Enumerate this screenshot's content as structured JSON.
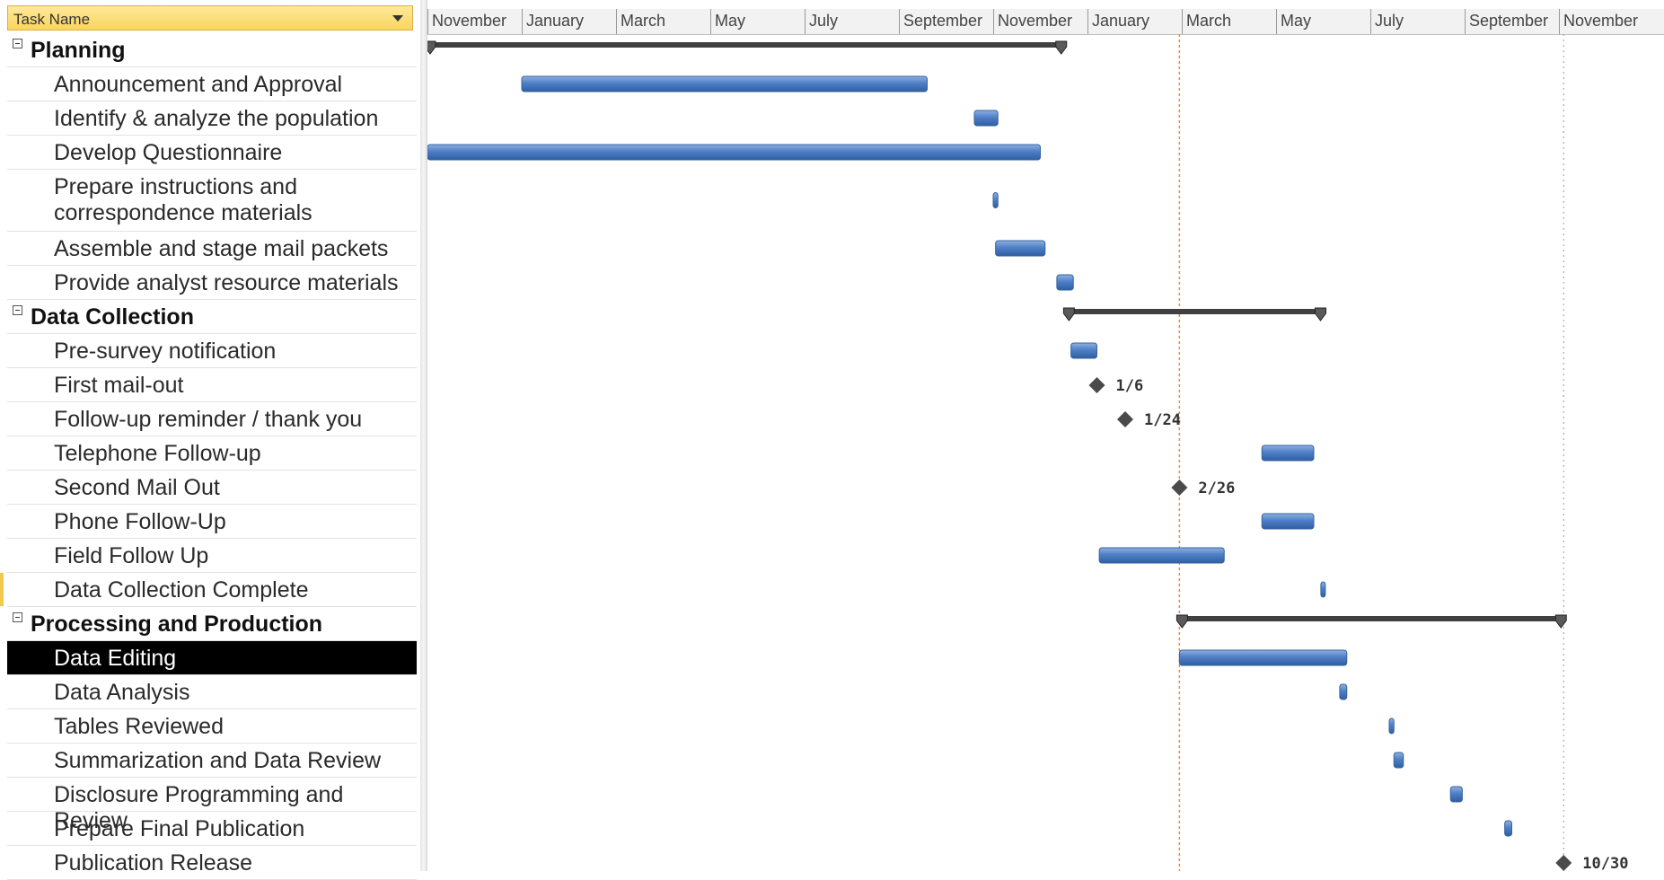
{
  "table": {
    "column_header": "Task Name",
    "header_menu_icon": "dropdown-arrow",
    "collapse_icon": "minus-box",
    "tasks": [
      {
        "label": "Planning",
        "type": "summary"
      },
      {
        "label": "Announcement and Approval",
        "type": "task"
      },
      {
        "label": "Identify & analyze the population",
        "type": "task"
      },
      {
        "label": "Develop Questionnaire",
        "type": "task"
      },
      {
        "label": "Prepare instructions and\ncorrespondence materials",
        "type": "task"
      },
      {
        "label": "Assemble and stage mail packets",
        "type": "task"
      },
      {
        "label": "Provide analyst resource materials",
        "type": "task"
      },
      {
        "label": "Data Collection",
        "type": "summary"
      },
      {
        "label": "Pre-survey notification",
        "type": "task"
      },
      {
        "label": "First mail-out",
        "type": "task"
      },
      {
        "label": "Follow-up reminder / thank you",
        "type": "task"
      },
      {
        "label": "Telephone Follow-up",
        "type": "task"
      },
      {
        "label": "Second Mail Out",
        "type": "task"
      },
      {
        "label": "Phone Follow-Up",
        "type": "task"
      },
      {
        "label": "Field Follow Up",
        "type": "task"
      },
      {
        "label": "Data Collection Complete",
        "type": "task",
        "marked": true
      },
      {
        "label": "Processing and Production",
        "type": "summary"
      },
      {
        "label": "Data Editing",
        "type": "task",
        "selected": true
      },
      {
        "label": "Data Analysis",
        "type": "task"
      },
      {
        "label": "Tables Reviewed",
        "type": "task"
      },
      {
        "label": "Summarization and Data Review",
        "type": "task"
      },
      {
        "label": "Disclosure Programming and Review",
        "type": "task"
      },
      {
        "label": "Prepare Final Publication",
        "type": "task"
      },
      {
        "label": "Publication Release",
        "type": "task"
      }
    ]
  },
  "timescale": {
    "months": [
      "November",
      "January",
      "March",
      "May",
      "July",
      "September",
      "November",
      "January",
      "March",
      "May",
      "July",
      "September",
      "November"
    ]
  },
  "gantt": {
    "bars": [
      {
        "row": 0,
        "kind": "summary",
        "start": 0,
        "end": 13.5
      },
      {
        "row": 1,
        "kind": "task",
        "start": 2.0,
        "end": 10.6
      },
      {
        "row": 2,
        "kind": "task",
        "start": 11.6,
        "end": 12.1
      },
      {
        "row": 3,
        "kind": "task",
        "start": 0,
        "end": 13.0
      },
      {
        "row": 4,
        "kind": "task",
        "start": 12.0,
        "end": 12.1
      },
      {
        "row": 5,
        "kind": "task",
        "start": 12.05,
        "end": 13.1
      },
      {
        "row": 6,
        "kind": "task",
        "start": 13.35,
        "end": 13.7
      },
      {
        "row": 7,
        "kind": "summary",
        "start": 13.55,
        "end": 19.0
      },
      {
        "row": 8,
        "kind": "task",
        "start": 13.65,
        "end": 14.2
      },
      {
        "row": 9,
        "kind": "milestone",
        "at": 14.2,
        "label": "1/6"
      },
      {
        "row": 10,
        "kind": "milestone",
        "at": 14.8,
        "label": "1/24"
      },
      {
        "row": 11,
        "kind": "task",
        "start": 17.7,
        "end": 18.8
      },
      {
        "row": 12,
        "kind": "milestone",
        "at": 15.95,
        "label": "2/26"
      },
      {
        "row": 13,
        "kind": "task",
        "start": 17.7,
        "end": 18.8
      },
      {
        "row": 14,
        "kind": "task",
        "start": 14.25,
        "end": 16.9
      },
      {
        "row": 15,
        "kind": "task",
        "start": 18.95,
        "end": 19.0
      },
      {
        "row": 16,
        "kind": "summary",
        "start": 15.95,
        "end": 24.1
      },
      {
        "row": 17,
        "kind": "task",
        "start": 15.95,
        "end": 19.5
      },
      {
        "row": 18,
        "kind": "task",
        "start": 19.35,
        "end": 19.5
      },
      {
        "row": 19,
        "kind": "task",
        "start": 20.4,
        "end": 20.5
      },
      {
        "row": 20,
        "kind": "task",
        "start": 20.5,
        "end": 20.7
      },
      {
        "row": 21,
        "kind": "task",
        "start": 21.7,
        "end": 21.95
      },
      {
        "row": 22,
        "kind": "task",
        "start": 22.85,
        "end": 23.0
      },
      {
        "row": 23,
        "kind": "milestone",
        "at": 24.1,
        "label": "10/30"
      }
    ],
    "status_line_at": 15.95,
    "deadline_line_at": 24.1
  }
}
